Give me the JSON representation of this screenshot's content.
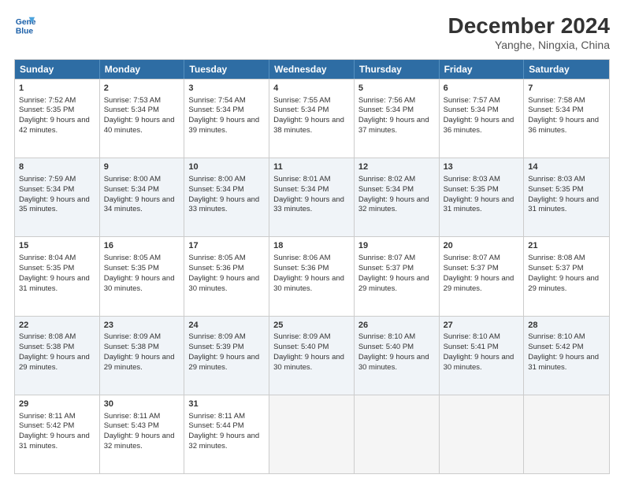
{
  "header": {
    "logo_line1": "General",
    "logo_line2": "Blue",
    "title": "December 2024",
    "subtitle": "Yanghe, Ningxia, China"
  },
  "days_of_week": [
    "Sunday",
    "Monday",
    "Tuesday",
    "Wednesday",
    "Thursday",
    "Friday",
    "Saturday"
  ],
  "weeks": [
    [
      {
        "day": "1",
        "rise": "Sunrise: 7:52 AM",
        "set": "Sunset: 5:35 PM",
        "daylight": "Daylight: 9 hours and 42 minutes."
      },
      {
        "day": "2",
        "rise": "Sunrise: 7:53 AM",
        "set": "Sunset: 5:34 PM",
        "daylight": "Daylight: 9 hours and 40 minutes."
      },
      {
        "day": "3",
        "rise": "Sunrise: 7:54 AM",
        "set": "Sunset: 5:34 PM",
        "daylight": "Daylight: 9 hours and 39 minutes."
      },
      {
        "day": "4",
        "rise": "Sunrise: 7:55 AM",
        "set": "Sunset: 5:34 PM",
        "daylight": "Daylight: 9 hours and 38 minutes."
      },
      {
        "day": "5",
        "rise": "Sunrise: 7:56 AM",
        "set": "Sunset: 5:34 PM",
        "daylight": "Daylight: 9 hours and 37 minutes."
      },
      {
        "day": "6",
        "rise": "Sunrise: 7:57 AM",
        "set": "Sunset: 5:34 PM",
        "daylight": "Daylight: 9 hours and 36 minutes."
      },
      {
        "day": "7",
        "rise": "Sunrise: 7:58 AM",
        "set": "Sunset: 5:34 PM",
        "daylight": "Daylight: 9 hours and 36 minutes."
      }
    ],
    [
      {
        "day": "8",
        "rise": "Sunrise: 7:59 AM",
        "set": "Sunset: 5:34 PM",
        "daylight": "Daylight: 9 hours and 35 minutes."
      },
      {
        "day": "9",
        "rise": "Sunrise: 8:00 AM",
        "set": "Sunset: 5:34 PM",
        "daylight": "Daylight: 9 hours and 34 minutes."
      },
      {
        "day": "10",
        "rise": "Sunrise: 8:00 AM",
        "set": "Sunset: 5:34 PM",
        "daylight": "Daylight: 9 hours and 33 minutes."
      },
      {
        "day": "11",
        "rise": "Sunrise: 8:01 AM",
        "set": "Sunset: 5:34 PM",
        "daylight": "Daylight: 9 hours and 33 minutes."
      },
      {
        "day": "12",
        "rise": "Sunrise: 8:02 AM",
        "set": "Sunset: 5:34 PM",
        "daylight": "Daylight: 9 hours and 32 minutes."
      },
      {
        "day": "13",
        "rise": "Sunrise: 8:03 AM",
        "set": "Sunset: 5:35 PM",
        "daylight": "Daylight: 9 hours and 31 minutes."
      },
      {
        "day": "14",
        "rise": "Sunrise: 8:03 AM",
        "set": "Sunset: 5:35 PM",
        "daylight": "Daylight: 9 hours and 31 minutes."
      }
    ],
    [
      {
        "day": "15",
        "rise": "Sunrise: 8:04 AM",
        "set": "Sunset: 5:35 PM",
        "daylight": "Daylight: 9 hours and 31 minutes."
      },
      {
        "day": "16",
        "rise": "Sunrise: 8:05 AM",
        "set": "Sunset: 5:35 PM",
        "daylight": "Daylight: 9 hours and 30 minutes."
      },
      {
        "day": "17",
        "rise": "Sunrise: 8:05 AM",
        "set": "Sunset: 5:36 PM",
        "daylight": "Daylight: 9 hours and 30 minutes."
      },
      {
        "day": "18",
        "rise": "Sunrise: 8:06 AM",
        "set": "Sunset: 5:36 PM",
        "daylight": "Daylight: 9 hours and 30 minutes."
      },
      {
        "day": "19",
        "rise": "Sunrise: 8:07 AM",
        "set": "Sunset: 5:37 PM",
        "daylight": "Daylight: 9 hours and 29 minutes."
      },
      {
        "day": "20",
        "rise": "Sunrise: 8:07 AM",
        "set": "Sunset: 5:37 PM",
        "daylight": "Daylight: 9 hours and 29 minutes."
      },
      {
        "day": "21",
        "rise": "Sunrise: 8:08 AM",
        "set": "Sunset: 5:37 PM",
        "daylight": "Daylight: 9 hours and 29 minutes."
      }
    ],
    [
      {
        "day": "22",
        "rise": "Sunrise: 8:08 AM",
        "set": "Sunset: 5:38 PM",
        "daylight": "Daylight: 9 hours and 29 minutes."
      },
      {
        "day": "23",
        "rise": "Sunrise: 8:09 AM",
        "set": "Sunset: 5:38 PM",
        "daylight": "Daylight: 9 hours and 29 minutes."
      },
      {
        "day": "24",
        "rise": "Sunrise: 8:09 AM",
        "set": "Sunset: 5:39 PM",
        "daylight": "Daylight: 9 hours and 29 minutes."
      },
      {
        "day": "25",
        "rise": "Sunrise: 8:09 AM",
        "set": "Sunset: 5:40 PM",
        "daylight": "Daylight: 9 hours and 30 minutes."
      },
      {
        "day": "26",
        "rise": "Sunrise: 8:10 AM",
        "set": "Sunset: 5:40 PM",
        "daylight": "Daylight: 9 hours and 30 minutes."
      },
      {
        "day": "27",
        "rise": "Sunrise: 8:10 AM",
        "set": "Sunset: 5:41 PM",
        "daylight": "Daylight: 9 hours and 30 minutes."
      },
      {
        "day": "28",
        "rise": "Sunrise: 8:10 AM",
        "set": "Sunset: 5:42 PM",
        "daylight": "Daylight: 9 hours and 31 minutes."
      }
    ],
    [
      {
        "day": "29",
        "rise": "Sunrise: 8:11 AM",
        "set": "Sunset: 5:42 PM",
        "daylight": "Daylight: 9 hours and 31 minutes."
      },
      {
        "day": "30",
        "rise": "Sunrise: 8:11 AM",
        "set": "Sunset: 5:43 PM",
        "daylight": "Daylight: 9 hours and 32 minutes."
      },
      {
        "day": "31",
        "rise": "Sunrise: 8:11 AM",
        "set": "Sunset: 5:44 PM",
        "daylight": "Daylight: 9 hours and 32 minutes."
      },
      null,
      null,
      null,
      null
    ]
  ]
}
